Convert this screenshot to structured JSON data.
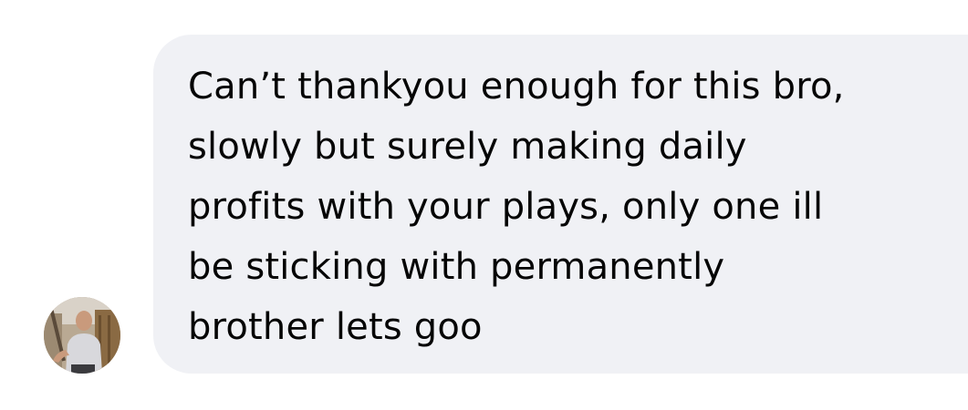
{
  "conversation": {
    "message": {
      "text": "Can’t thankyou enough for this bro,\nslowly but surely making daily\nprofits with your plays, only one ill\nbe sticking with permanently\nbrother lets goo"
    },
    "sender": {
      "avatar_icon": "user-photo-avatar"
    }
  },
  "colors": {
    "bubble_background": "#f0f1f5",
    "text": "#050505",
    "page_background": "#ffffff"
  }
}
